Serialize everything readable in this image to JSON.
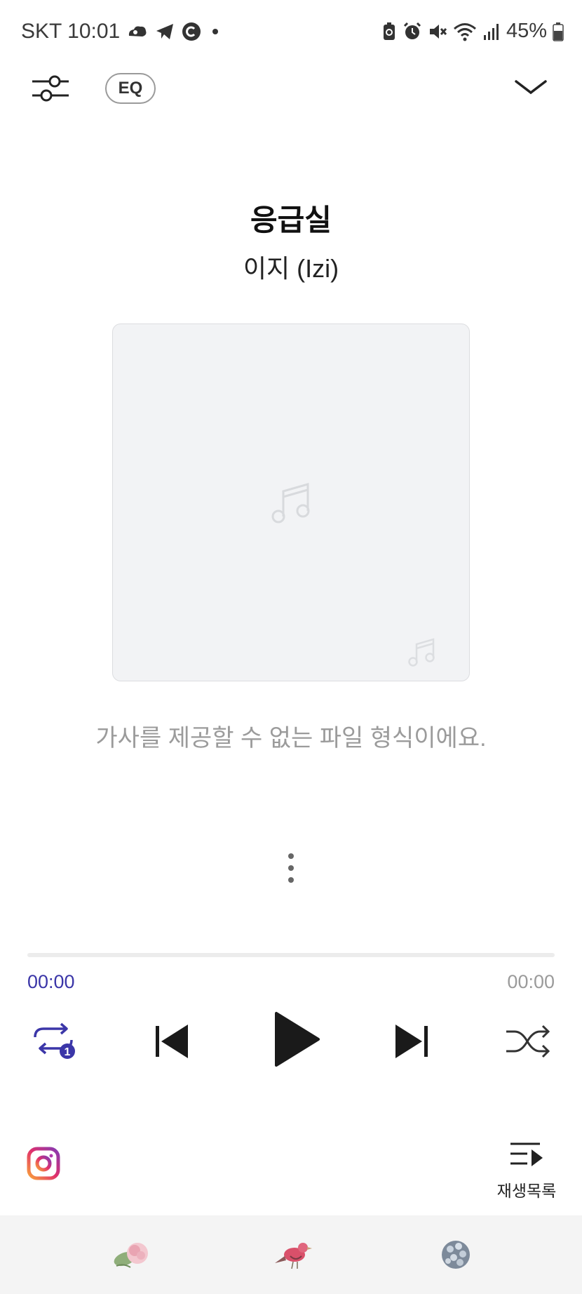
{
  "status_bar": {
    "carrier_time": "SKT 10:01",
    "battery": "45%",
    "icons": [
      "cloud-hand-icon",
      "telegram-icon",
      "c-icon",
      "dot-icon",
      "battery-saver-icon",
      "alarm-icon",
      "mute-icon",
      "wifi-icon",
      "signal-icon",
      "battery-icon"
    ]
  },
  "top_bar": {
    "eq_label": "EQ",
    "icons": [
      "sliders-icon",
      "chevron-down-icon"
    ]
  },
  "track": {
    "title": "응급실",
    "artist": "이지 (Izi)"
  },
  "album_art": {
    "icons": [
      "music-note-icon",
      "music-note-small-icon"
    ]
  },
  "lyrics": {
    "message": "가사를 제공할 수 없는 파일 형식이에요."
  },
  "progress": {
    "current_time": "00:00",
    "total_time": "00:00",
    "fraction": 0
  },
  "controls": {
    "repeat_badge": "1",
    "icons": [
      "repeat-one-icon",
      "previous-icon",
      "play-icon",
      "next-icon",
      "shuffle-icon"
    ]
  },
  "bottom_actions": {
    "playlist_label": "재생목록",
    "icons": [
      "instagram-icon",
      "playlist-icon"
    ]
  },
  "bottom_nav": {
    "items": [
      "flower-icon",
      "bird-icon",
      "hydrangea-icon"
    ]
  },
  "colors": {
    "accent": "#3b36a8",
    "muted_text": "#9b9b9b",
    "album_bg": "#f2f3f5",
    "nav_bg": "#f4f4f4"
  }
}
